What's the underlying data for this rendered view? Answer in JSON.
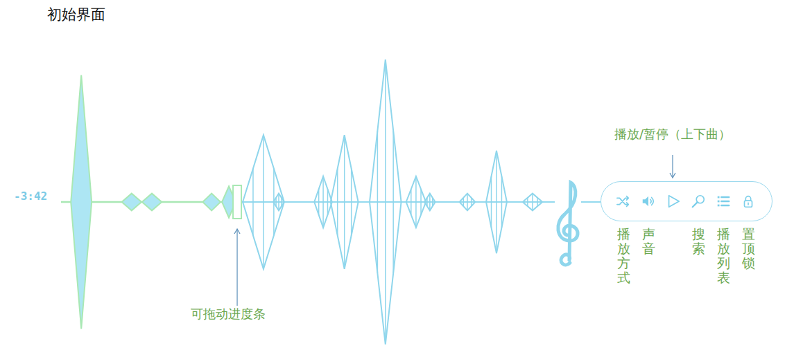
{
  "title": "初始界面",
  "player": {
    "time": "-3:42",
    "progress": 0.354,
    "progress_note": "可拖动进度条",
    "waveform": {
      "peaks": [
        {
          "t": 0.041,
          "amp": 0.89,
          "span": 0.021
        },
        {
          "t": 0.143,
          "amp": 0.06,
          "span": 0.02
        },
        {
          "t": 0.184,
          "amp": 0.06,
          "span": 0.02
        },
        {
          "t": 0.305,
          "amp": 0.06,
          "span": 0.018
        },
        {
          "t": 0.34,
          "amp": 0.11,
          "span": 0.014
        },
        {
          "t": 0.41,
          "amp": 0.47,
          "span": 0.042
        },
        {
          "t": 0.441,
          "amp": 0.06,
          "span": 0.011
        },
        {
          "t": 0.531,
          "amp": 0.18,
          "span": 0.018
        },
        {
          "t": 0.574,
          "amp": 0.47,
          "span": 0.028
        },
        {
          "t": 0.657,
          "amp": 1.0,
          "span": 0.032
        },
        {
          "t": 0.719,
          "amp": 0.18,
          "span": 0.02
        },
        {
          "t": 0.747,
          "amp": 0.06,
          "span": 0.011
        },
        {
          "t": 0.823,
          "amp": 0.06,
          "span": 0.016
        },
        {
          "t": 0.882,
          "amp": 0.36,
          "span": 0.021
        },
        {
          "t": 0.955,
          "amp": 0.06,
          "span": 0.02
        }
      ]
    },
    "controls": [
      {
        "note": "播放方式",
        "kind": "below"
      },
      {
        "note": "声音",
        "kind": "below"
      },
      {
        "note": "播放/暂停（上下曲）",
        "kind": "above"
      },
      {
        "note": "搜索",
        "kind": "below"
      },
      {
        "note": "播放列表",
        "kind": "below"
      },
      {
        "note": "置顶锁",
        "kind": "below"
      }
    ]
  }
}
